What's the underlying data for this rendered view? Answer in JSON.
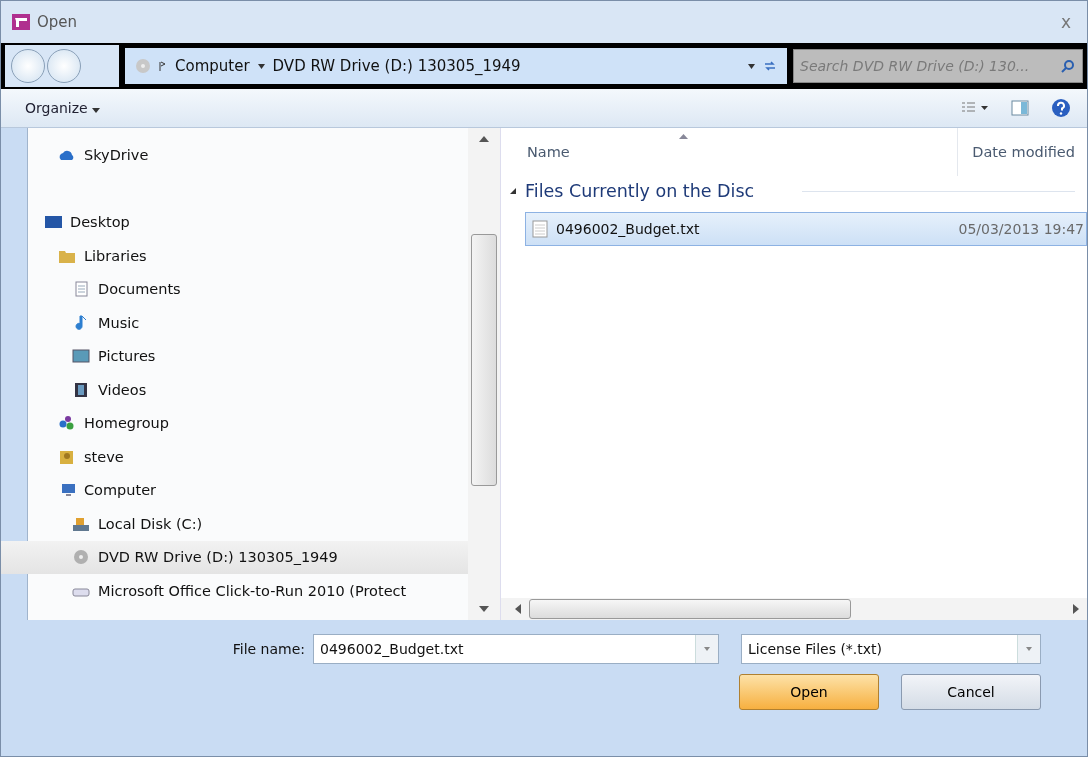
{
  "window": {
    "title": "Open",
    "close": "x"
  },
  "address_bar": {
    "segments": [
      "Computer",
      "DVD RW Drive (D:) 130305_1949"
    ],
    "search": {
      "placeholder": "Search DVD RW Drive (D:) 130..."
    }
  },
  "toolbar": {
    "organize": "Organize"
  },
  "nav_tree": [
    {
      "label": "SkyDrive",
      "kind": "cloud",
      "selected": false
    },
    {
      "label": "Desktop",
      "kind": "desktop",
      "selected": false,
      "children": [
        {
          "label": "Libraries",
          "kind": "library",
          "selected": false,
          "children": [
            {
              "label": "Documents",
              "kind": "document",
              "selected": false
            },
            {
              "label": "Music",
              "kind": "music",
              "selected": false
            },
            {
              "label": "Pictures",
              "kind": "picture",
              "selected": false
            },
            {
              "label": "Videos",
              "kind": "video",
              "selected": false
            }
          ]
        },
        {
          "label": "Homegroup",
          "kind": "homegroup",
          "selected": false
        },
        {
          "label": "steve",
          "kind": "user",
          "selected": false
        },
        {
          "label": "Computer",
          "kind": "computer",
          "selected": false,
          "children": [
            {
              "label": "Local Disk (C:)",
              "kind": "disk",
              "selected": false
            },
            {
              "label": "DVD RW Drive (D:) 130305_1949",
              "kind": "dvd",
              "selected": true
            },
            {
              "label": "Microsoft Office Click-to-Run 2010 (Protect",
              "kind": "drive",
              "selected": false
            }
          ]
        }
      ]
    }
  ],
  "file_list": {
    "columns": [
      "Name",
      "Date modified"
    ],
    "group": {
      "title": "Files Currently on the Disc",
      "expanded": true
    },
    "rows": [
      {
        "name": "0496002_Budget.txt",
        "date": "05/03/2013 19:47",
        "selected": true
      }
    ]
  },
  "footer": {
    "file_name_label": "File name:",
    "file_name": "0496002_Budget.txt",
    "file_type": "License Files (*.txt)",
    "buttons": [
      "Open",
      "Cancel"
    ]
  }
}
